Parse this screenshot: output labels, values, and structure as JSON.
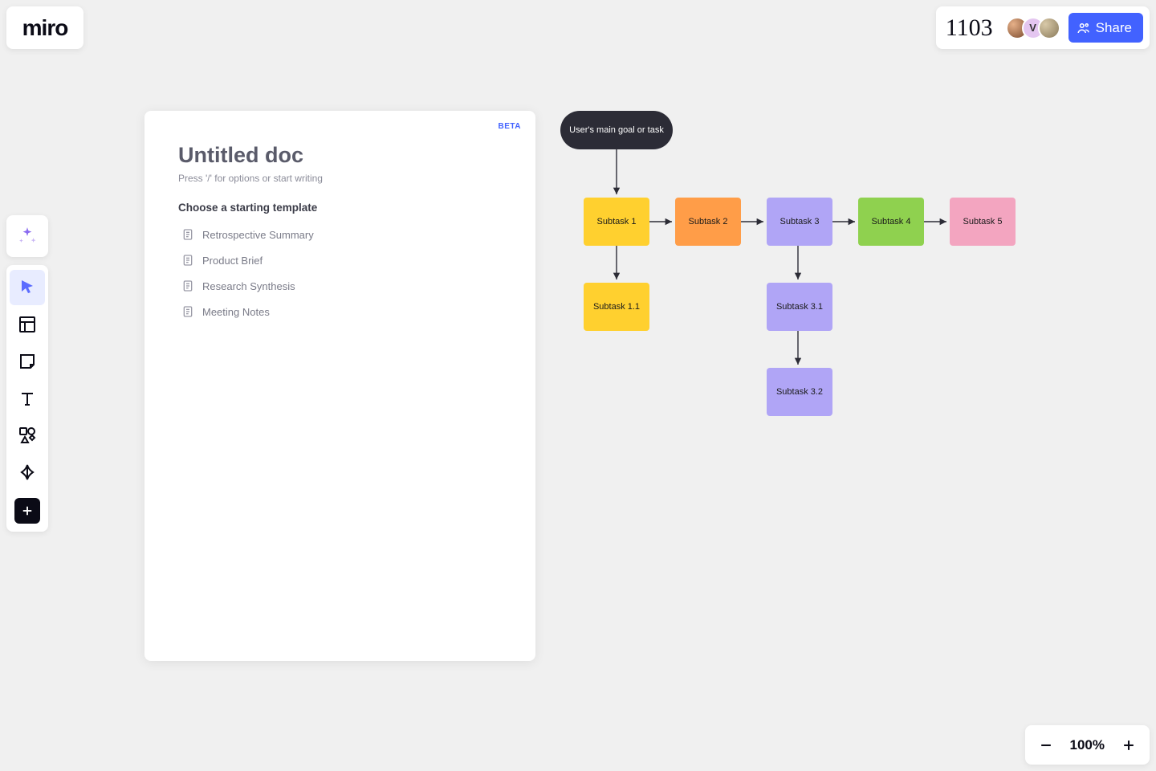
{
  "app": {
    "name": "miro"
  },
  "header": {
    "collaborator_count": "1103",
    "avatars": [
      {
        "initial": "",
        "cls": "av1"
      },
      {
        "initial": "V",
        "cls": "av2"
      },
      {
        "initial": "",
        "cls": "av3"
      }
    ],
    "share_label": "Share"
  },
  "toolbar": {
    "tools": [
      "select",
      "templates",
      "sticky",
      "text",
      "shapes",
      "pen"
    ]
  },
  "zoom": {
    "level": "100%"
  },
  "doc": {
    "badge": "BETA",
    "title": "Untitled doc",
    "hint": "Press '/' for options or start writing",
    "section_label": "Choose a starting template",
    "templates": [
      "Retrospective Summary",
      "Product Brief",
      "Research Synthesis",
      "Meeting Notes"
    ]
  },
  "flow": {
    "root": "User's main goal or task",
    "nodes": {
      "s1": "Subtask 1",
      "s2": "Subtask 2",
      "s3": "Subtask 3",
      "s4": "Subtask 4",
      "s5": "Subtask 5",
      "s11": "Subtask 1.1",
      "s31": "Subtask 3.1",
      "s32": "Subtask 3.2"
    }
  }
}
